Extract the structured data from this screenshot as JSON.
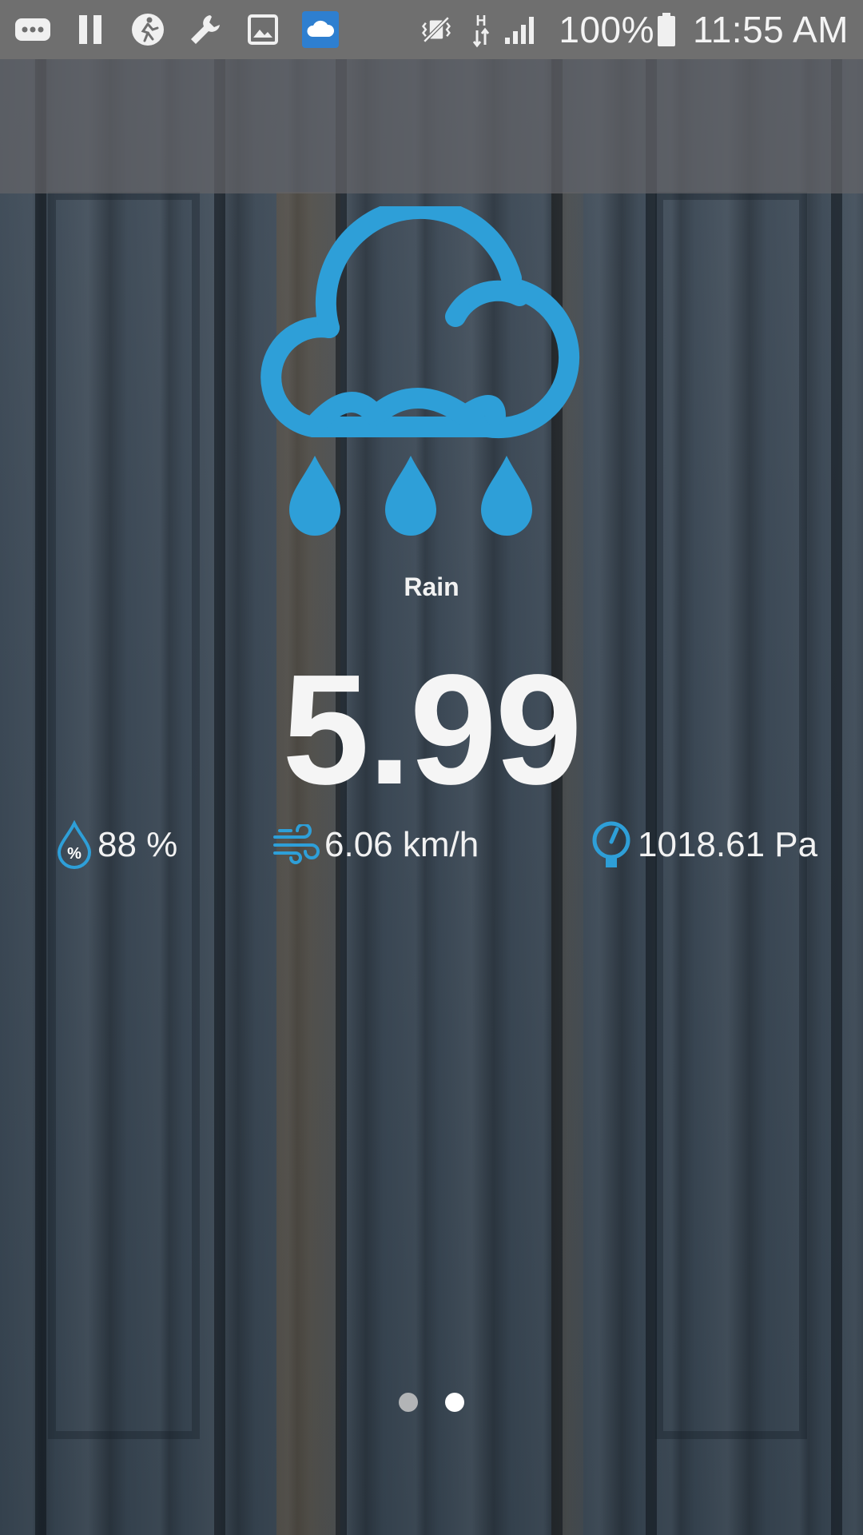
{
  "status_bar": {
    "icons_left": [
      "more-icon",
      "pause-icon",
      "fitness-icon",
      "wrench-icon",
      "image-icon",
      "weather-app-icon"
    ],
    "icons_right": [
      "vibrate-off-icon",
      "hspa-icon",
      "signal-icon",
      "battery-icon"
    ],
    "battery": "100%",
    "time": "11:55 AM"
  },
  "weather": {
    "icon": "cloud-rain-icon",
    "condition": "Rain",
    "value": "5.99",
    "accent_color": "#2e9fd8"
  },
  "metrics": {
    "humidity": {
      "icon": "humidity-drop-icon",
      "text": "88 %"
    },
    "wind": {
      "icon": "wind-icon",
      "text": "6.06 km/h"
    },
    "pressure": {
      "icon": "pressure-gauge-icon",
      "text": "1018.61 Pa"
    }
  },
  "pager": {
    "pages": 2,
    "current": 2
  }
}
